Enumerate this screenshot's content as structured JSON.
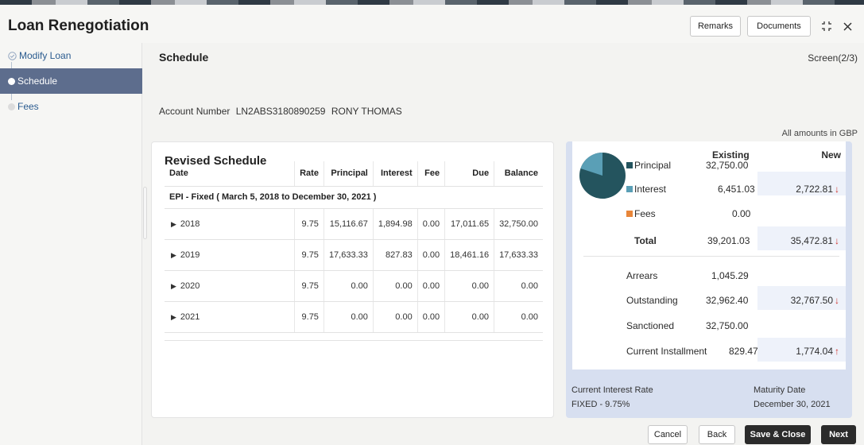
{
  "header": {
    "title": "Loan Renegotiation",
    "remarks_label": "Remarks",
    "documents_label": "Documents"
  },
  "sidebar": {
    "items": [
      {
        "label": "Modify Loan",
        "state": "done"
      },
      {
        "label": "Schedule",
        "state": "active"
      },
      {
        "label": "Fees",
        "state": "pending"
      }
    ]
  },
  "main": {
    "title": "Schedule",
    "screen": "Screen(2/3)",
    "account_label": "Account Number",
    "account_number": "LN2ABS3180890259",
    "customer_name": "RONY THOMAS",
    "amounts_note": "All amounts in GBP"
  },
  "revised_schedule": {
    "title": "Revised Schedule",
    "columns": [
      "Date",
      "Rate",
      "Principal",
      "Interest",
      "Fee",
      "Due",
      "Balance"
    ],
    "group_label": "EPI - Fixed ( March 5, 2018 to December 30, 2021 )",
    "rows": [
      {
        "date": "2018",
        "rate": "9.75",
        "principal": "15,116.67",
        "interest": "1,894.98",
        "fee": "0.00",
        "due": "17,011.65",
        "balance": "32,750.00"
      },
      {
        "date": "2019",
        "rate": "9.75",
        "principal": "17,633.33",
        "interest": "827.83",
        "fee": "0.00",
        "due": "18,461.16",
        "balance": "17,633.33"
      },
      {
        "date": "2020",
        "rate": "9.75",
        "principal": "0.00",
        "interest": "0.00",
        "fee": "0.00",
        "due": "0.00",
        "balance": "0.00"
      },
      {
        "date": "2021",
        "rate": "9.75",
        "principal": "0.00",
        "interest": "0.00",
        "fee": "0.00",
        "due": "0.00",
        "balance": "0.00"
      }
    ]
  },
  "summary": {
    "existing_header": "Existing",
    "new_header": "New",
    "principal_label": "Principal",
    "principal_existing": "32,750.00",
    "interest_label": "Interest",
    "interest_existing": "6,451.03",
    "interest_new": "2,722.81",
    "fees_label": "Fees",
    "fees_existing": "0.00",
    "total_label": "Total",
    "total_existing": "39,201.03",
    "total_new": "35,472.81",
    "arrears_label": "Arrears",
    "arrears_existing": "1,045.29",
    "outstanding_label": "Outstanding",
    "outstanding_existing": "32,962.40",
    "outstanding_new": "32,767.50",
    "sanctioned_label": "Sanctioned",
    "sanctioned_existing": "32,750.00",
    "installment_label": "Current Installment",
    "installment_existing": "829.47",
    "installment_new": "1,774.04",
    "interest_rate_label": "Current Interest Rate",
    "interest_rate_value": "FIXED - 9.75%",
    "maturity_label": "Maturity Date",
    "maturity_value": "December 30, 2021",
    "colors": {
      "principal": "#24545e",
      "interest": "#5a9fb6",
      "fees": "#e8863a"
    }
  },
  "footer": {
    "cancel_label": "Cancel",
    "back_label": "Back",
    "save_close_label": "Save & Close",
    "next_label": "Next"
  }
}
